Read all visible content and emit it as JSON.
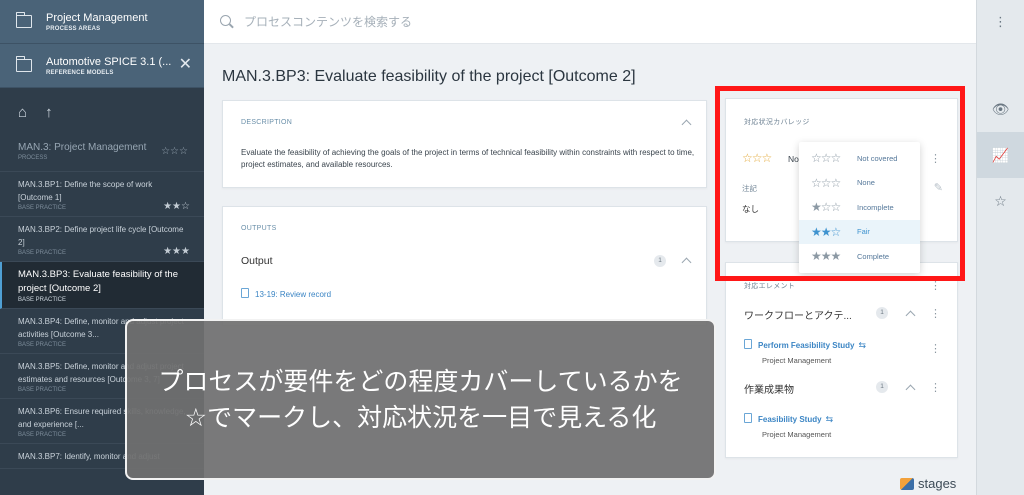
{
  "sidebar": {
    "header1": {
      "title": "Project Management",
      "subtitle": "PROCESS AREAS"
    },
    "header2": {
      "title": "Automotive SPICE 3.1 (...",
      "subtitle": "REFERENCE MODELS"
    },
    "process": {
      "title": "MAN.3: Project Management",
      "subtitle": "PROCESS",
      "stars": "☆☆☆"
    },
    "items": [
      {
        "title": "MAN.3.BP1: Define the scope of work [Outcome 1]",
        "subtitle": "BASE PRACTICE",
        "stars": "★★☆"
      },
      {
        "title": "MAN.3.BP2: Define project life cycle [Outcome 2]",
        "subtitle": "BASE PRACTICE",
        "stars": "★★★"
      },
      {
        "title": "MAN.3.BP3: Evaluate feasibility of the project [Outcome 2]",
        "subtitle": "BASE PRACTICE",
        "stars": ""
      },
      {
        "title": "MAN.3.BP4: Define, monitor and adjust project activities [Outcome 3...",
        "subtitle": "BASE PRACTICE",
        "stars": ""
      },
      {
        "title": "MAN.3.BP5: Define, monitor and adjust project estimates and resources [Outcome 3, 7]",
        "subtitle": "BASE PRACTICE",
        "stars": ""
      },
      {
        "title": "MAN.3.BP6: Ensure required skills, knowledge, and experience [...",
        "subtitle": "BASE PRACTICE",
        "stars": ""
      },
      {
        "title": "MAN.3.BP7: Identify, monitor and adjust",
        "subtitle": "",
        "stars": ""
      }
    ]
  },
  "search": {
    "placeholder": "プロセスコンテンツを検索する"
  },
  "main": {
    "title": "MAN.3.BP3: Evaluate feasibility of the project [Outcome 2]",
    "description": {
      "label": "DESCRIPTION",
      "text": "Evaluate the feasibility of achieving the goals of the project in terms of technical feasibility within constraints with respect to time, project estimates, and available resources."
    },
    "outputs": {
      "label": "OUTPUTS",
      "row_title": "Output",
      "count": "1",
      "link": "13-19: Review record"
    }
  },
  "coverage": {
    "label": "対応状況カバレッジ",
    "current_stars": "☆☆☆",
    "current_text": "No",
    "note_label": "注記",
    "note_value": "なし",
    "options": [
      {
        "stars": "☆☆☆",
        "label": "Not covered",
        "filled": 0
      },
      {
        "stars": "☆☆☆",
        "label": "None",
        "filled": 0
      },
      {
        "stars": "★☆☆",
        "label": "Incomplete",
        "filled": 1
      },
      {
        "stars": "★★☆",
        "label": "Fair",
        "filled": 2
      },
      {
        "stars": "★★★",
        "label": "Complete",
        "filled": 3
      }
    ]
  },
  "related": {
    "label": "対応エレメント",
    "groups": [
      {
        "title": "ワークフローとアクテ...",
        "count": "1",
        "link": "Perform Feasibility Study",
        "sub": "Project Management"
      },
      {
        "title": "作業成果物",
        "count": "1",
        "link": "Feasibility Study",
        "sub": "Project Management"
      }
    ]
  },
  "overlay": {
    "line1": "プロセスが要件をどの程度カバーしているかを",
    "line2": "☆でマークし、対応状況を一目で見える化"
  },
  "brand": "stages",
  "colors": {
    "highlight_frame": "#ff1717",
    "accent": "#3b85c4",
    "sidebar": "#2f3d4a"
  }
}
